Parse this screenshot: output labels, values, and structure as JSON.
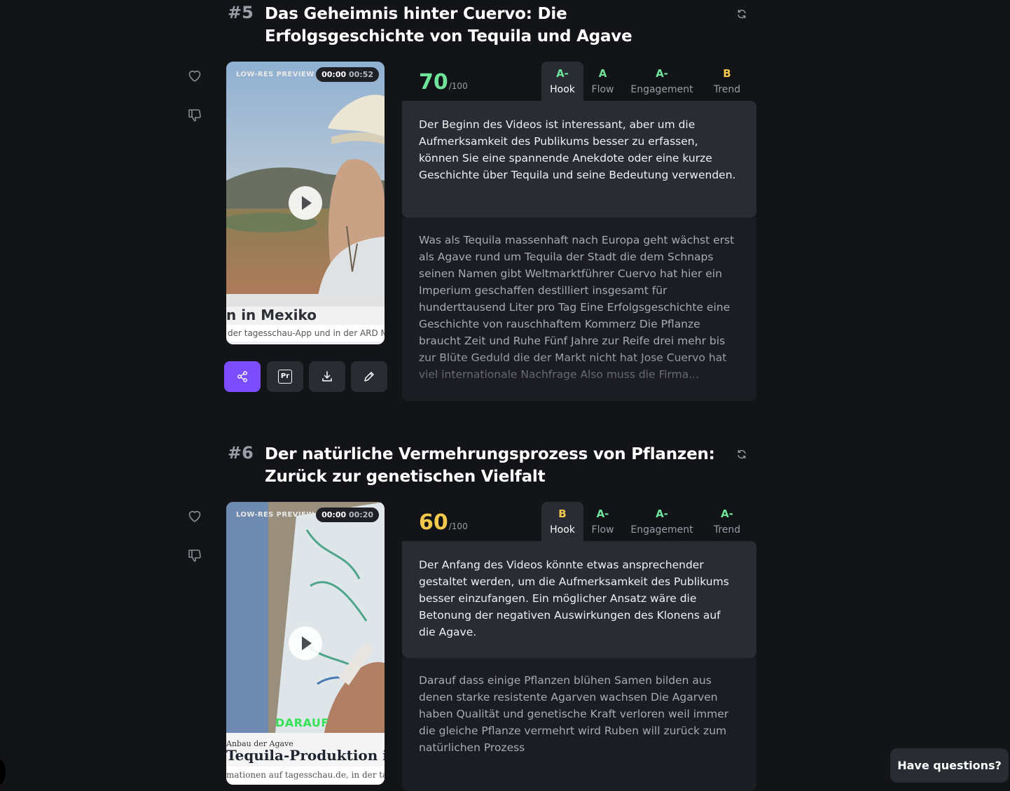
{
  "clips": [
    {
      "rank": "#5",
      "title": "Das Geheimnis hinter Cuervo: Die Erfolgsgeschichte von Tequila und Agave",
      "preview_label": "LOW-RES PREVIEW",
      "time_current": "00:00",
      "time_total": "00:52",
      "overlay_title": "n in Mexiko",
      "overlay_caption": "der tagesschau-App und in der ARD Med",
      "score": "70",
      "score_max": "/100",
      "score_color": "#6fe39a",
      "tabs": [
        {
          "grade": "A-",
          "label": "Hook",
          "color": "#6fe39a",
          "active": true
        },
        {
          "grade": "A",
          "label": "Flow",
          "color": "#6fe39a",
          "active": false
        },
        {
          "grade": "A-",
          "label": "Engagement",
          "color": "#6fe39a",
          "active": false
        },
        {
          "grade": "B",
          "label": "Trend",
          "color": "#f2c94c",
          "active": false
        }
      ],
      "feedback": "Der Beginn des Videos ist interessant, aber um die Aufmerksamkeit des Publikums besser zu erfassen, können Sie eine spannende Anekdote oder eine kurze Geschichte über Tequila und seine Bedeutung verwenden.",
      "transcript": "Was als Tequila massenhaft nach Europa geht wächst erst als Agave rund um Tequila der Stadt die dem Schnaps seinen Namen gibt Weltmarktführer Cuervo hat hier ein Imperium geschaffen destilliert insgesamt für hunderttausend Liter pro Tag Eine Erfolgsgeschichte eine Geschichte von rauschhaftem Kommerz Die Pflanze braucht Zeit und Ruhe Fünf Jahre zur Reife drei mehr bis zur Blüte Geduld die der Markt nicht hat Jose Cuervo hat viel internationale Nachfrage Also muss die Firma..."
    },
    {
      "rank": "#6",
      "title": "Der natürliche Vermehrungsprozess von Pflanzen: Zurück zur genetischen Vielfalt",
      "preview_label": "LOW-RES PREVIEW",
      "time_current": "00:00",
      "time_total": "00:20",
      "overlay_highlight": "DARAUF",
      "overlay_kicker": "Anbau der Agave",
      "overlay_title": "Tequila-Produktion in I",
      "overlay_caption": "mationen auf tagesschau.de, in der tage",
      "score": "60",
      "score_max": "/100",
      "score_color": "#f2c94c",
      "tabs": [
        {
          "grade": "B",
          "label": "Hook",
          "color": "#f2c94c",
          "active": true
        },
        {
          "grade": "A-",
          "label": "Flow",
          "color": "#6fe39a",
          "active": false
        },
        {
          "grade": "A-",
          "label": "Engagement",
          "color": "#6fe39a",
          "active": false
        },
        {
          "grade": "A-",
          "label": "Trend",
          "color": "#6fe39a",
          "active": false
        }
      ],
      "feedback": "Der Anfang des Videos könnte etwas ansprechender gestaltet werden, um die Aufmerksamkeit des Publikums besser einzufangen. Ein möglicher Ansatz wäre die Betonung der negativen Auswirkungen des Klonens auf die Agave.",
      "transcript": "Darauf dass einige Pflanzen blühen Samen bilden aus denen starke resistente Agarven wachsen Die Agarven haben Qualität und genetische Kraft verloren weil immer die gleiche Pflanze vermehrt wird Ruben will zurück zum natürlichen Prozess"
    }
  ],
  "actions": {
    "share_icon": "share-icon",
    "premiere_label": "Pr",
    "download_icon": "download-icon",
    "edit_icon": "pencil-icon"
  },
  "help_button": "Have questions?",
  "colors": {
    "accent": "#7c4dff",
    "grade_good": "#6fe39a",
    "grade_mid": "#f2c94c",
    "background": "#131418",
    "panel": "#2a2c34"
  }
}
